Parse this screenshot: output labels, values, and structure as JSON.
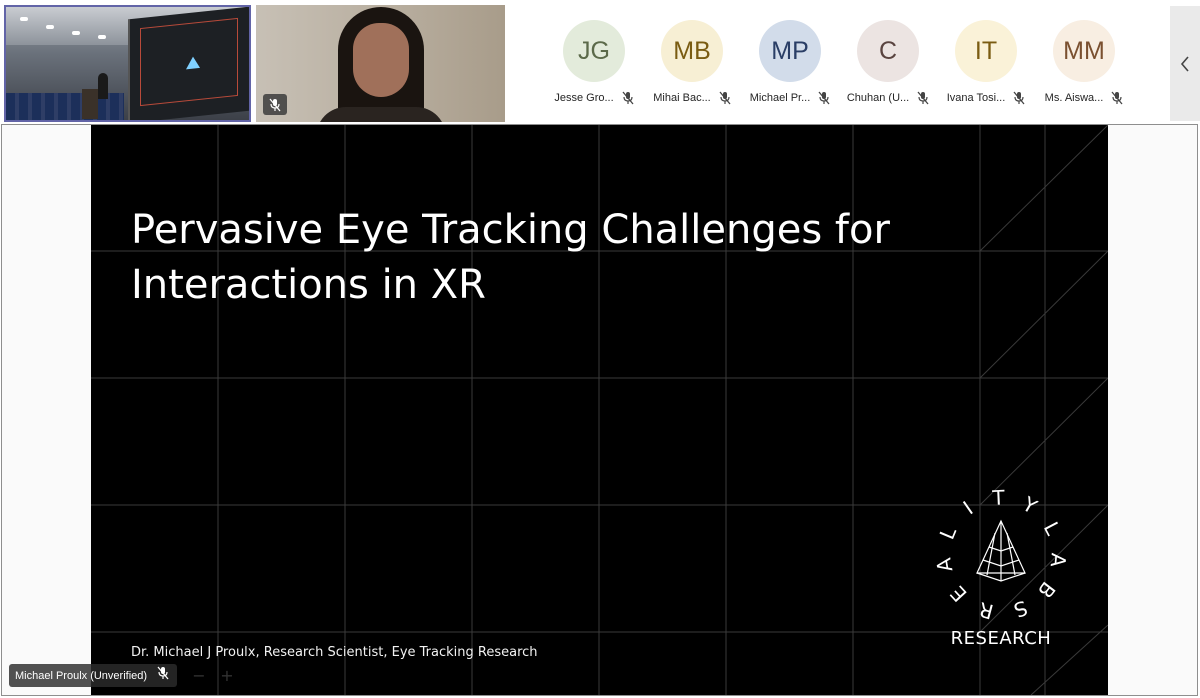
{
  "participants": [
    {
      "initials": "JG",
      "name": "Jesse Gro...",
      "avatar_bg": "#e3ebdb",
      "initials_color": "#5c6a4a",
      "muted": true
    },
    {
      "initials": "MB",
      "name": "Mihai Bac...",
      "avatar_bg": "#f7efd4",
      "initials_color": "#7a5c12",
      "muted": true
    },
    {
      "initials": "MP",
      "name": "Michael Pr...",
      "avatar_bg": "#d2dcea",
      "initials_color": "#2a3e66",
      "muted": true
    },
    {
      "initials": "C",
      "name": "Chuhan (U...",
      "avatar_bg": "#ece4e2",
      "initials_color": "#5a4440",
      "muted": true
    },
    {
      "initials": "IT",
      "name": "Ivana Tosi...",
      "avatar_bg": "#faf2d8",
      "initials_color": "#7a5c12",
      "muted": true
    },
    {
      "initials": "MM",
      "name": "Ms. Aiswa...",
      "avatar_bg": "#f8eee2",
      "initials_color": "#7a5030",
      "muted": true
    }
  ],
  "slide": {
    "title_line1": "Pervasive Eye Tracking Challenges for",
    "title_line2": "Interactions in XR",
    "footer": "Dr. Michael J Proulx, Research Scientist, Eye Tracking Research",
    "logo_ring_text": [
      "R",
      "E",
      "A",
      "L",
      "I",
      "T",
      "Y",
      "L",
      "A",
      "B",
      "S"
    ],
    "logo_research": "RESEARCH"
  },
  "presenter": {
    "label": "Michael Proulx (Unverified)"
  },
  "controls": {
    "zoom_out": "−",
    "zoom_in": "+"
  },
  "colors": {
    "accent": "#6264a7",
    "slide_bg": "#000000",
    "grid_line": "#3a3a3a"
  },
  "icons": {
    "mute": "mic-off-icon",
    "panel_toggle": "chevron-left-icon"
  }
}
